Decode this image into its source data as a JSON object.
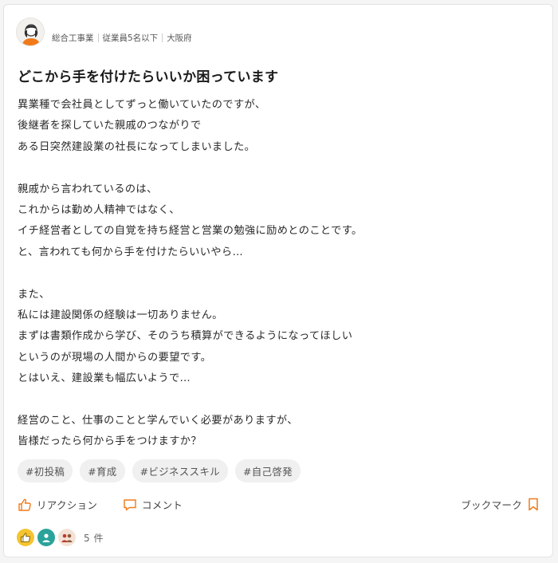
{
  "post": {
    "meta": [
      "総合工事業",
      "従業員5名以下",
      "大阪府"
    ],
    "title": "どこから手を付けたらいいか困っています",
    "body_lines": [
      "異業種で会社員としてずっと働いていたのですが、",
      "後継者を探していた親戚のつながりで",
      "ある日突然建設業の社長になってしまいました。",
      "",
      "親戚から言われているのは、",
      "これからは勤め人精神ではなく、",
      "イチ経営者としての自覚を持ち経営と営業の勉強に励めとのことです。",
      "と、言われても何から手を付けたらいいやら…",
      "",
      "また、",
      "私には建設関係の経験は一切ありません。",
      "まずは書類作成から学び、そのうち積算ができるようになってほしい",
      "というのが現場の人間からの要望です。",
      "とはいえ、建設業も幅広いようで…",
      "",
      "経営のこと、仕事のことと学んでいく必要がありますが、",
      "皆様だったら何から手をつけますか？"
    ],
    "tags": [
      "#初投稿",
      "#育成",
      "#ビジネススキル",
      "#自己啓発"
    ]
  },
  "actions": {
    "reaction_label": "リアクション",
    "comment_label": "コメント",
    "bookmark_label": "ブックマーク"
  },
  "reactions": {
    "icons": [
      "thumbs-up-icon",
      "person-icon",
      "group-icon"
    ],
    "count_label": "5 件"
  },
  "colors": {
    "accent": "#f07a1a",
    "reaction_yellow": "#f4c430",
    "reaction_teal": "#2aa39a"
  }
}
